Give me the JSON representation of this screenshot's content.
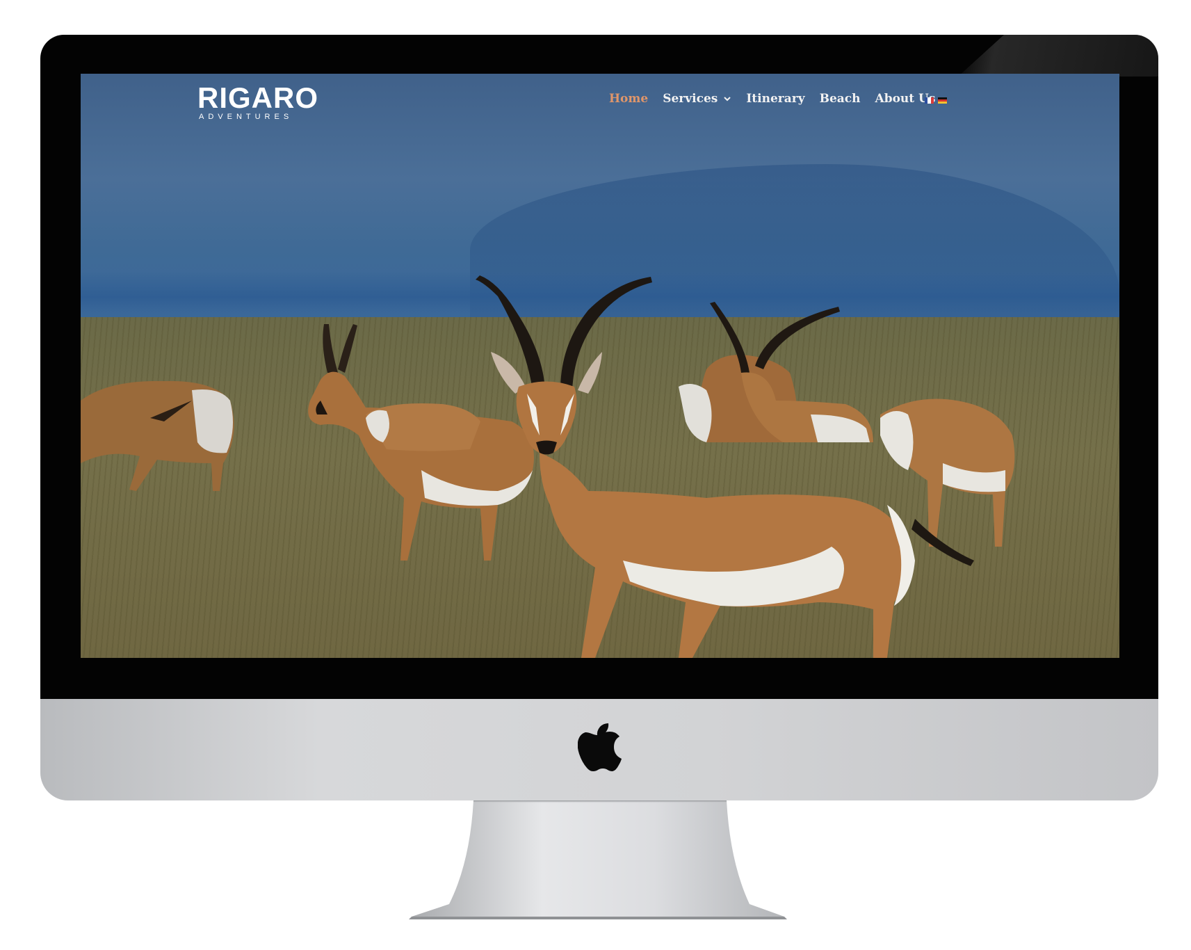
{
  "site": {
    "logo": {
      "main": "RIGARO",
      "sub": "ADVENTURES"
    },
    "nav": {
      "items": [
        {
          "label": "Home",
          "active": true
        },
        {
          "label": "Services",
          "has_dropdown": true
        },
        {
          "label": "Itinerary"
        },
        {
          "label": "Beach"
        },
        {
          "label": "About Us"
        }
      ],
      "languages": [
        "french-flag-icon",
        "german-flag-icon"
      ]
    },
    "hero": {
      "image": "gazelles-on-savanna"
    }
  },
  "colors": {
    "nav_active": "#e0966a",
    "nav_text": "#f2f2f2",
    "bezel": "#030303",
    "chin": "#d2d3d5"
  }
}
